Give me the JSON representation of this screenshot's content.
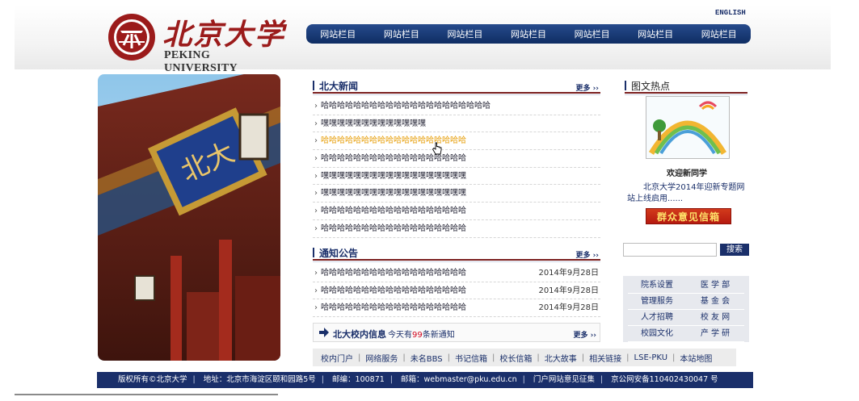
{
  "header": {
    "logo_cn": "北京大学",
    "logo_en": "PEKING UNIVERSITY",
    "english_link": "ENGLISH"
  },
  "nav": {
    "items": [
      "网站栏目",
      "网站栏目",
      "网站栏目",
      "网站栏目",
      "网站栏目",
      "网站栏目",
      "网站栏目"
    ]
  },
  "news": {
    "title": "北大新闻",
    "more": "更多 ››",
    "items": [
      "哈哈哈哈哈哈哈哈哈哈哈哈哈哈哈哈哈哈哈哈哈",
      "嘿嘿嘿嘿嘿嘿嘿嘿嘿嘿嘿嘿嘿",
      "哈哈哈哈哈哈哈哈哈哈哈哈哈哈哈哈哈哈",
      "哈哈哈哈哈哈哈哈哈哈哈哈哈哈哈哈哈哈",
      "嘿嘿嘿嘿嘿嘿嘿嘿嘿嘿嘿嘿嘿嘿嘿嘿嘿嘿",
      "嘿嘿嘿嘿嘿嘿嘿嘿嘿嘿嘿嘿嘿嘿嘿嘿嘿嘿",
      "哈哈哈哈哈哈哈哈哈哈哈哈哈哈哈哈哈哈",
      "哈哈哈哈哈哈哈哈哈哈哈哈哈哈哈哈哈哈"
    ]
  },
  "notices": {
    "title": "通知公告",
    "more": "更多 ››",
    "items": [
      {
        "text": "哈哈哈哈哈哈哈哈哈哈哈哈哈哈哈哈哈哈",
        "date": "2014年9月28日"
      },
      {
        "text": "哈哈哈哈哈哈哈哈哈哈哈哈哈哈哈哈哈哈",
        "date": "2014年9月28日"
      },
      {
        "text": "哈哈哈哈哈哈哈哈哈哈哈哈哈哈哈哈哈哈",
        "date": "2014年9月28日"
      }
    ]
  },
  "campus_info": {
    "title": "北大校内信息",
    "count_prefix": "今天有",
    "count": "99",
    "count_suffix": "条新通知",
    "more": "更多 ››"
  },
  "links_bar": [
    "校内门户",
    "网络服务",
    "未名BBS",
    "书记信箱",
    "校长信箱",
    "北大故事",
    "相关链接",
    "LSE-PKU",
    "本站地图"
  ],
  "hot": {
    "title": "图文热点",
    "caption": "欢迎新同学",
    "text": "北京大学2014年迎新专题网站上线启用......",
    "opinion_button": "群众意见信箱"
  },
  "search": {
    "placeholder": "",
    "button": "搜索"
  },
  "quick_links": [
    "院系设置",
    "医 学 部",
    "管理服务",
    "基 金 会",
    "人才招聘",
    "校 友 网",
    "校园文化",
    "产 学 研"
  ],
  "footer": {
    "copyright": "版权所有©北京大学",
    "address": "地址：北京市海淀区颐和园路5号",
    "postcode": "邮编：100871",
    "email": "邮箱：webmaster@pku.edu.cn",
    "feedback": "门户网站意见征集",
    "icp": "京公网安备110402430047 号"
  },
  "colors": {
    "brand_red": "#9b1b1b",
    "navy": "#1a2f6a",
    "hover_orange": "#e69b00"
  }
}
